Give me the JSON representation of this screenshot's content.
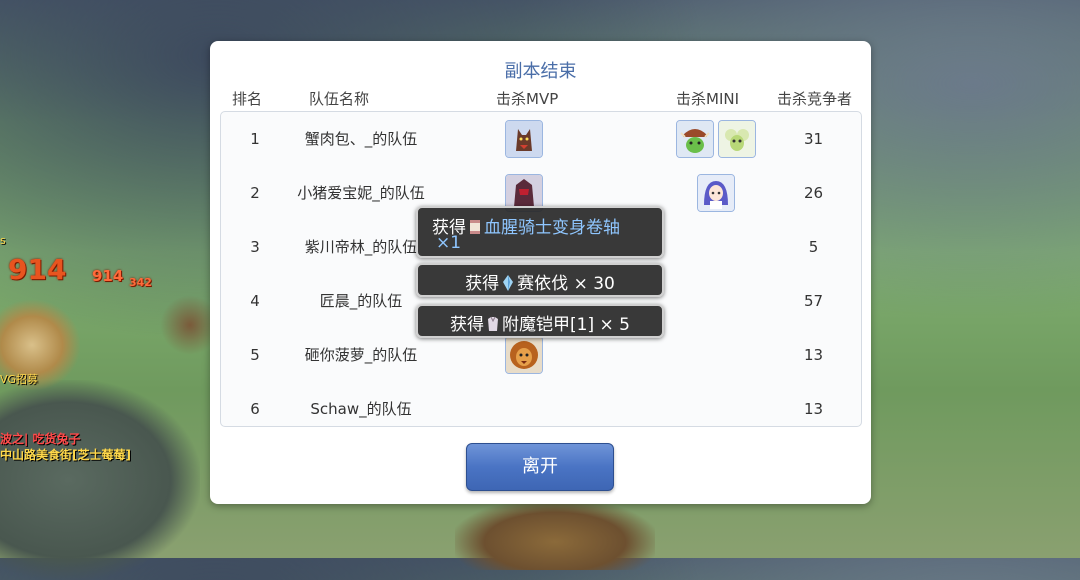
{
  "background": {
    "damage_big": "914",
    "damage_small": "914",
    "damage_tiny": "342",
    "tag1": "s",
    "tag2": "VG招募",
    "player_name": "波之| 吃货兔子",
    "player_guild": "中山路美食街[芝士莓莓]"
  },
  "panel": {
    "title": "副本结束",
    "headers": {
      "rank": "排名",
      "team": "队伍名称",
      "mvp": "击杀MVP",
      "mini": "击杀MINI",
      "kills": "击杀竞争者"
    },
    "rows": [
      {
        "rank": "1",
        "team": "蟹肉包、_的队伍",
        "kills": "31",
        "mvp": [
          "wolf-mvp-icon"
        ],
        "mini": [
          "goblin-mini-icon",
          "bug-mini-icon"
        ]
      },
      {
        "rank": "2",
        "team": "小猪爱宝妮_的队伍",
        "kills": "26",
        "mvp": [
          "knight-mvp-icon"
        ],
        "mini": [
          "girl-mini-icon"
        ]
      },
      {
        "rank": "3",
        "team": "紫川帝林_的队伍",
        "kills": "5",
        "mvp": [],
        "mini": []
      },
      {
        "rank": "4",
        "team": "匠晨_的队伍",
        "kills": "57",
        "mvp": [],
        "mini": []
      },
      {
        "rank": "5",
        "team": "砸你菠萝_的队伍",
        "kills": "13",
        "mvp": [
          "lion-mvp-icon"
        ],
        "mini": []
      },
      {
        "rank": "6",
        "team": "Schaw_的队伍",
        "kills": "13",
        "mvp": [],
        "mini": []
      }
    ],
    "leave_label": "离开"
  },
  "toasts": [
    {
      "label": "获得",
      "item": "血腥骑士变身卷轴",
      "qty": "×1",
      "icon": "scroll-icon"
    },
    {
      "label": "获得",
      "item": "赛依伐",
      "qty": "× 30",
      "icon": "crystal-icon"
    },
    {
      "label": "获得",
      "item": "附魔铠甲[1]",
      "qty": "× 5",
      "icon": "armor-icon"
    }
  ],
  "colors": {
    "title": "#4a6ea8",
    "item_name": "#8fc6ff",
    "button": "#4a74c4",
    "damage": "#e8541f"
  }
}
